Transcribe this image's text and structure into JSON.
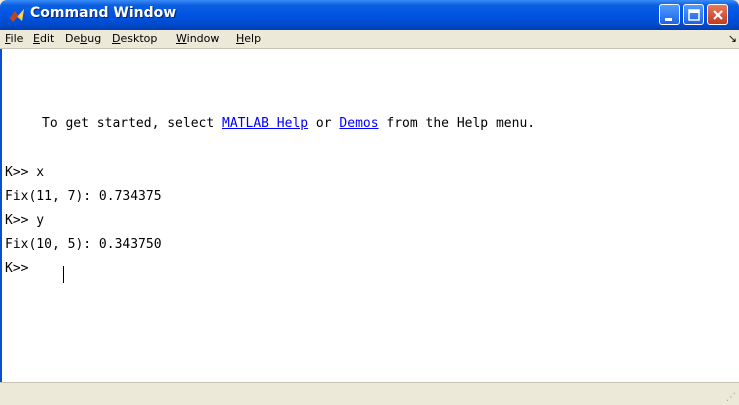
{
  "window": {
    "title": "Command Window",
    "buttons": {
      "minimize": "minimize",
      "maximize": "maximize",
      "close": "close"
    }
  },
  "menu": {
    "items": [
      {
        "label": "File",
        "mnemonic": "F"
      },
      {
        "label": "Edit",
        "mnemonic": "E"
      },
      {
        "label": "Debug",
        "mnemonic": "b"
      },
      {
        "label": "Desktop",
        "mnemonic": "D"
      },
      {
        "label": "Window",
        "mnemonic": "W"
      },
      {
        "label": "Help",
        "mnemonic": "H"
      }
    ],
    "overflow_glyph": "↘"
  },
  "console": {
    "intro_prefix": "To get started, select ",
    "intro_link1": "MATLAB Help",
    "intro_middle": " or ",
    "intro_link2": "Demos",
    "intro_suffix": " from the Help menu.",
    "lines": [
      "K>> x",
      "Fix(11, 7): 0.734375",
      "K>> y",
      "Fix(10, 5): 0.343750",
      "K>> "
    ]
  },
  "colors": {
    "title_bar": "#0054e3",
    "link": "#0000ff",
    "close_button": "#c4391d",
    "chrome": "#ece9d8"
  },
  "icons": {
    "app": "matlab-logo-icon",
    "grip": "resize-grip-icon"
  }
}
